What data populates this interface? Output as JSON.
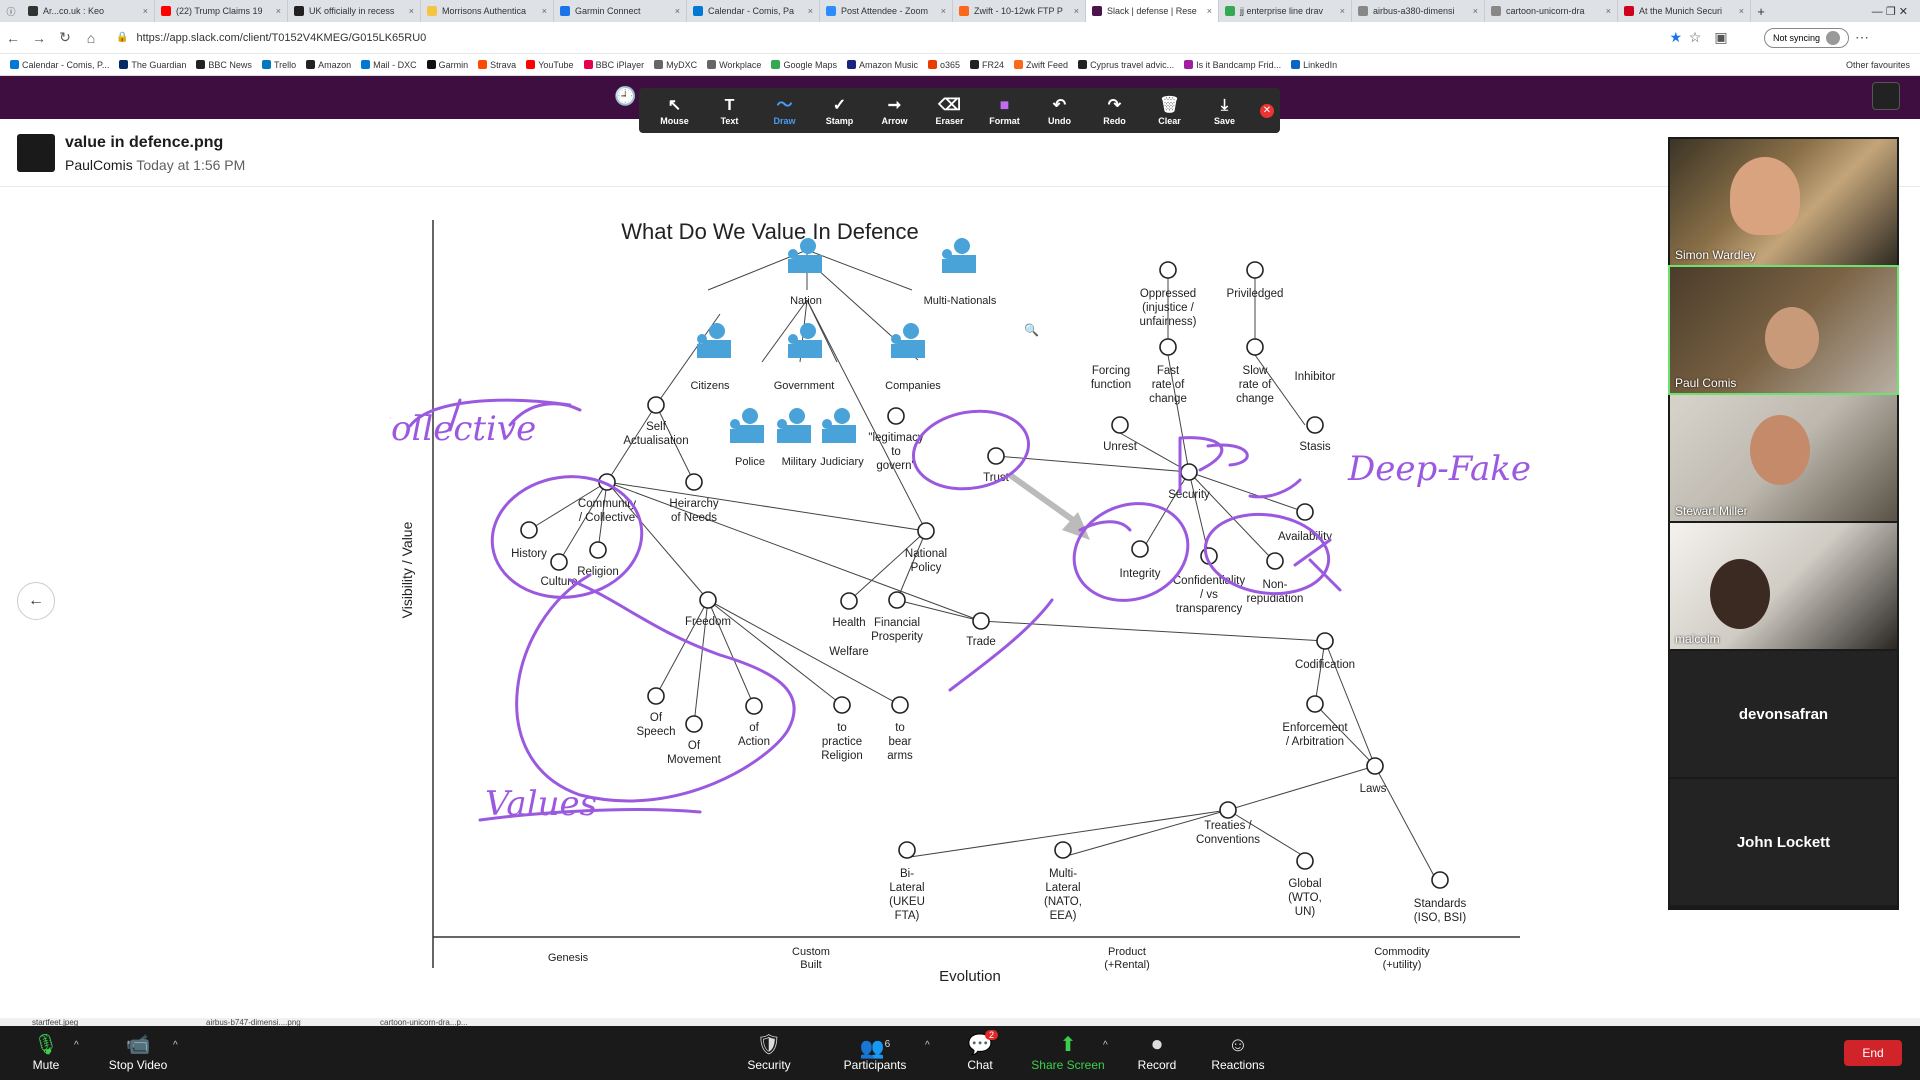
{
  "browser": {
    "tabs": [
      {
        "label": "Ar...co.uk : Keo",
        "color": "#333"
      },
      {
        "label": "(22) Trump Claims 19",
        "color": "#ff0000"
      },
      {
        "label": "UK officially in recess",
        "color": "#222"
      },
      {
        "label": "Morrisons Authentica",
        "color": "#f4c542"
      },
      {
        "label": "Garmin Connect",
        "color": "#1a73e8"
      },
      {
        "label": "Calendar - Comis, Pa",
        "color": "#0078d4"
      },
      {
        "label": "Post Attendee - Zoom",
        "color": "#2d8cff"
      },
      {
        "label": "Zwift - 10-12wk FTP P",
        "color": "#fc6719"
      },
      {
        "label": "Slack | defense | Rese",
        "color": "#4a154b",
        "active": true
      },
      {
        "label": "jj enterprise line drav",
        "color": "#34a853"
      },
      {
        "label": "airbus-a380-dimensi",
        "color": "#888"
      },
      {
        "label": "cartoon-unicorn-dra",
        "color": "#888"
      },
      {
        "label": "At the Munich Securi",
        "color": "#d0021b"
      }
    ],
    "url": "https://app.slack.com/client/T0152V4KMEG/G015LK65RU0",
    "sync_label": "Not syncing",
    "bookmarks": [
      {
        "label": "Calendar - Comis, P...",
        "color": "#0078d4"
      },
      {
        "label": "The Guardian",
        "color": "#052962"
      },
      {
        "label": "BBC News",
        "color": "#222"
      },
      {
        "label": "Trello",
        "color": "#0079bf"
      },
      {
        "label": "Amazon",
        "color": "#222"
      },
      {
        "label": "Mail - DXC",
        "color": "#0078d4"
      },
      {
        "label": "Garmin",
        "color": "#111"
      },
      {
        "label": "Strava",
        "color": "#fc4c02"
      },
      {
        "label": "YouTube",
        "color": "#ff0000"
      },
      {
        "label": "BBC iPlayer",
        "color": "#e4004b"
      },
      {
        "label": "MyDXC",
        "color": "#666"
      },
      {
        "label": "Workplace",
        "color": "#666"
      },
      {
        "label": "Google Maps",
        "color": "#34a853"
      },
      {
        "label": "Amazon Music",
        "color": "#1a237e"
      },
      {
        "label": "o365",
        "color": "#eb3c00"
      },
      {
        "label": "FR24",
        "color": "#222"
      },
      {
        "label": "Zwift Feed",
        "color": "#fc6719"
      },
      {
        "label": "Cyprus travel advic...",
        "color": "#222"
      },
      {
        "label": "Is it Bandcamp Frid...",
        "color": "#a020a0"
      },
      {
        "label": "LinkedIn",
        "color": "#0a66c2"
      }
    ],
    "other_bookmarks": "Other favourites"
  },
  "annotation_toolbar": {
    "tools": [
      {
        "label": "Mouse",
        "icon": "↖"
      },
      {
        "label": "Text",
        "icon": "T"
      },
      {
        "label": "Draw",
        "icon": "〜",
        "selected": true
      },
      {
        "label": "Stamp",
        "icon": "✓"
      },
      {
        "label": "Arrow",
        "icon": "➞"
      },
      {
        "label": "Eraser",
        "icon": "⌫"
      },
      {
        "label": "Format",
        "icon": "■"
      },
      {
        "label": "Undo",
        "icon": "↶"
      },
      {
        "label": "Redo",
        "icon": "↷"
      },
      {
        "label": "Clear",
        "icon": "🗑"
      },
      {
        "label": "Save",
        "icon": "⤓"
      }
    ]
  },
  "file": {
    "name": "value in defence.png",
    "author": "PaulComis",
    "time": "Today at 1:56 PM"
  },
  "map": {
    "title": "What Do We Value In Defence",
    "ylabel": "Visibility / Value",
    "xlabel": "Evolution",
    "stages": [
      "Genesis",
      "Custom Built",
      "Product (+Rental)",
      "Commodity (+utility)"
    ],
    "users": [
      "Nation",
      "Multi-Nationals",
      "Citizens",
      "Government",
      "Companies",
      "Police",
      "Military",
      "Judiciary"
    ],
    "nodes": [
      "Self Actualisation",
      "Community / Collective",
      "Heirarchy of Needs",
      "History",
      "Culture",
      "Religion",
      "\"legitimacy to govern\"",
      "Trust",
      "National Policy",
      "Freedom",
      "Health Welfare",
      "Financial Prosperity",
      "Trade",
      "Of Speech",
      "Of Movement",
      "of Action",
      "to practice Religion",
      "to bear arms",
      "Oppressed (injustice / unfairness)",
      "Priviledged",
      "Forcing function",
      "Fast rate of change",
      "Slow rate of change",
      "Inhibitor",
      "Unrest",
      "Stasis",
      "Security",
      "Availability",
      "Integrity",
      "Confidentiality / vs transparency",
      "Non-repudiation",
      "Codification",
      "Enforcement / Arbitration",
      "Laws",
      "Treaties / Conventions",
      "Bi-Lateral (UKEU FTA)",
      "Multi-Lateral (NATO, EEA)",
      "Global (WTO, UN)",
      "Standards (ISO, BSI)"
    ],
    "handwriting": [
      "Collective",
      "Values",
      "Deep-Fake"
    ],
    "ink_color": "#9b59e0",
    "accent_color": "#4aa3d8"
  },
  "videos": {
    "participants": [
      {
        "name": "Simon Wardley"
      },
      {
        "name": "Paul Comis",
        "active": true
      },
      {
        "name": "Stewart Miller"
      },
      {
        "name": "malcolm"
      }
    ],
    "name_only": [
      "devonsafran",
      "John Lockett"
    ]
  },
  "downloads": [
    "startfeet.jpeg",
    "airbus-b747-dimensi....png",
    "cartoon-unicorn-dra...p..."
  ],
  "zoom_bar": {
    "mute": "Mute",
    "stop_video": "Stop Video",
    "security": "Security",
    "participants": "Participants",
    "participants_count": "6",
    "chat": "Chat",
    "chat_badge": "2",
    "share": "Share Screen",
    "record": "Record",
    "reactions": "Reactions",
    "end": "End"
  }
}
